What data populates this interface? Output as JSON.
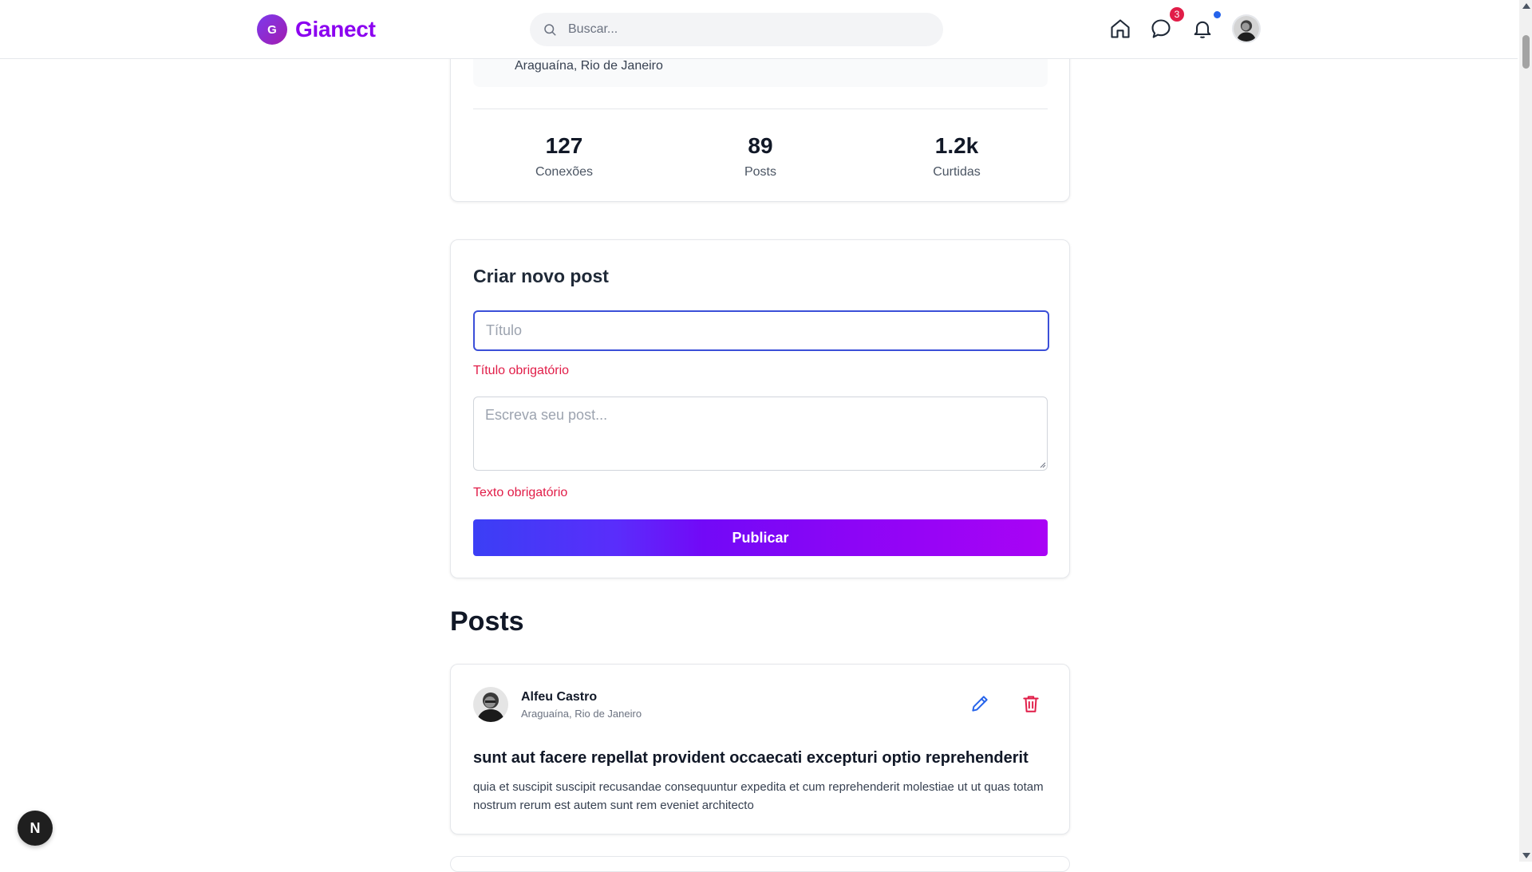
{
  "header": {
    "logo_letter": "G",
    "logo_text": "Gianect",
    "search_placeholder": "Buscar...",
    "messages_badge": "3",
    "icons": [
      "home-icon",
      "chat-icon",
      "bell-icon"
    ],
    "brand_color": "#8b00f0"
  },
  "profile": {
    "location": "Araguaína, Rio de Janeiro",
    "stats": [
      {
        "value": "127",
        "label": "Conexões"
      },
      {
        "value": "89",
        "label": "Posts"
      },
      {
        "value": "1.2k",
        "label": "Curtidas"
      }
    ]
  },
  "create_post": {
    "title": "Criar novo post",
    "title_placeholder": "Título",
    "title_error": "Título obrigatório",
    "body_placeholder": "Escreva seu post...",
    "body_error": "Texto obrigatório",
    "publish_label": "Publicar"
  },
  "posts_section": {
    "title": "Posts"
  },
  "posts": [
    {
      "author": "Alfeu Castro",
      "location": "Araguaína, Rio de Janeiro",
      "title": "sunt aut facere repellat provident occaecati excepturi optio reprehenderit",
      "body": "quia et suscipit suscipit recusandae consequuntur expedita et cum reprehenderit molestiae ut ut quas totam nostrum rerum est autem sunt rem eveniet architecto"
    }
  ],
  "dev_badge": "N",
  "colors": {
    "error": "#e11d48",
    "edit": "#2563eb",
    "delete": "#e11d48",
    "focus_border": "#3b4fd8"
  }
}
